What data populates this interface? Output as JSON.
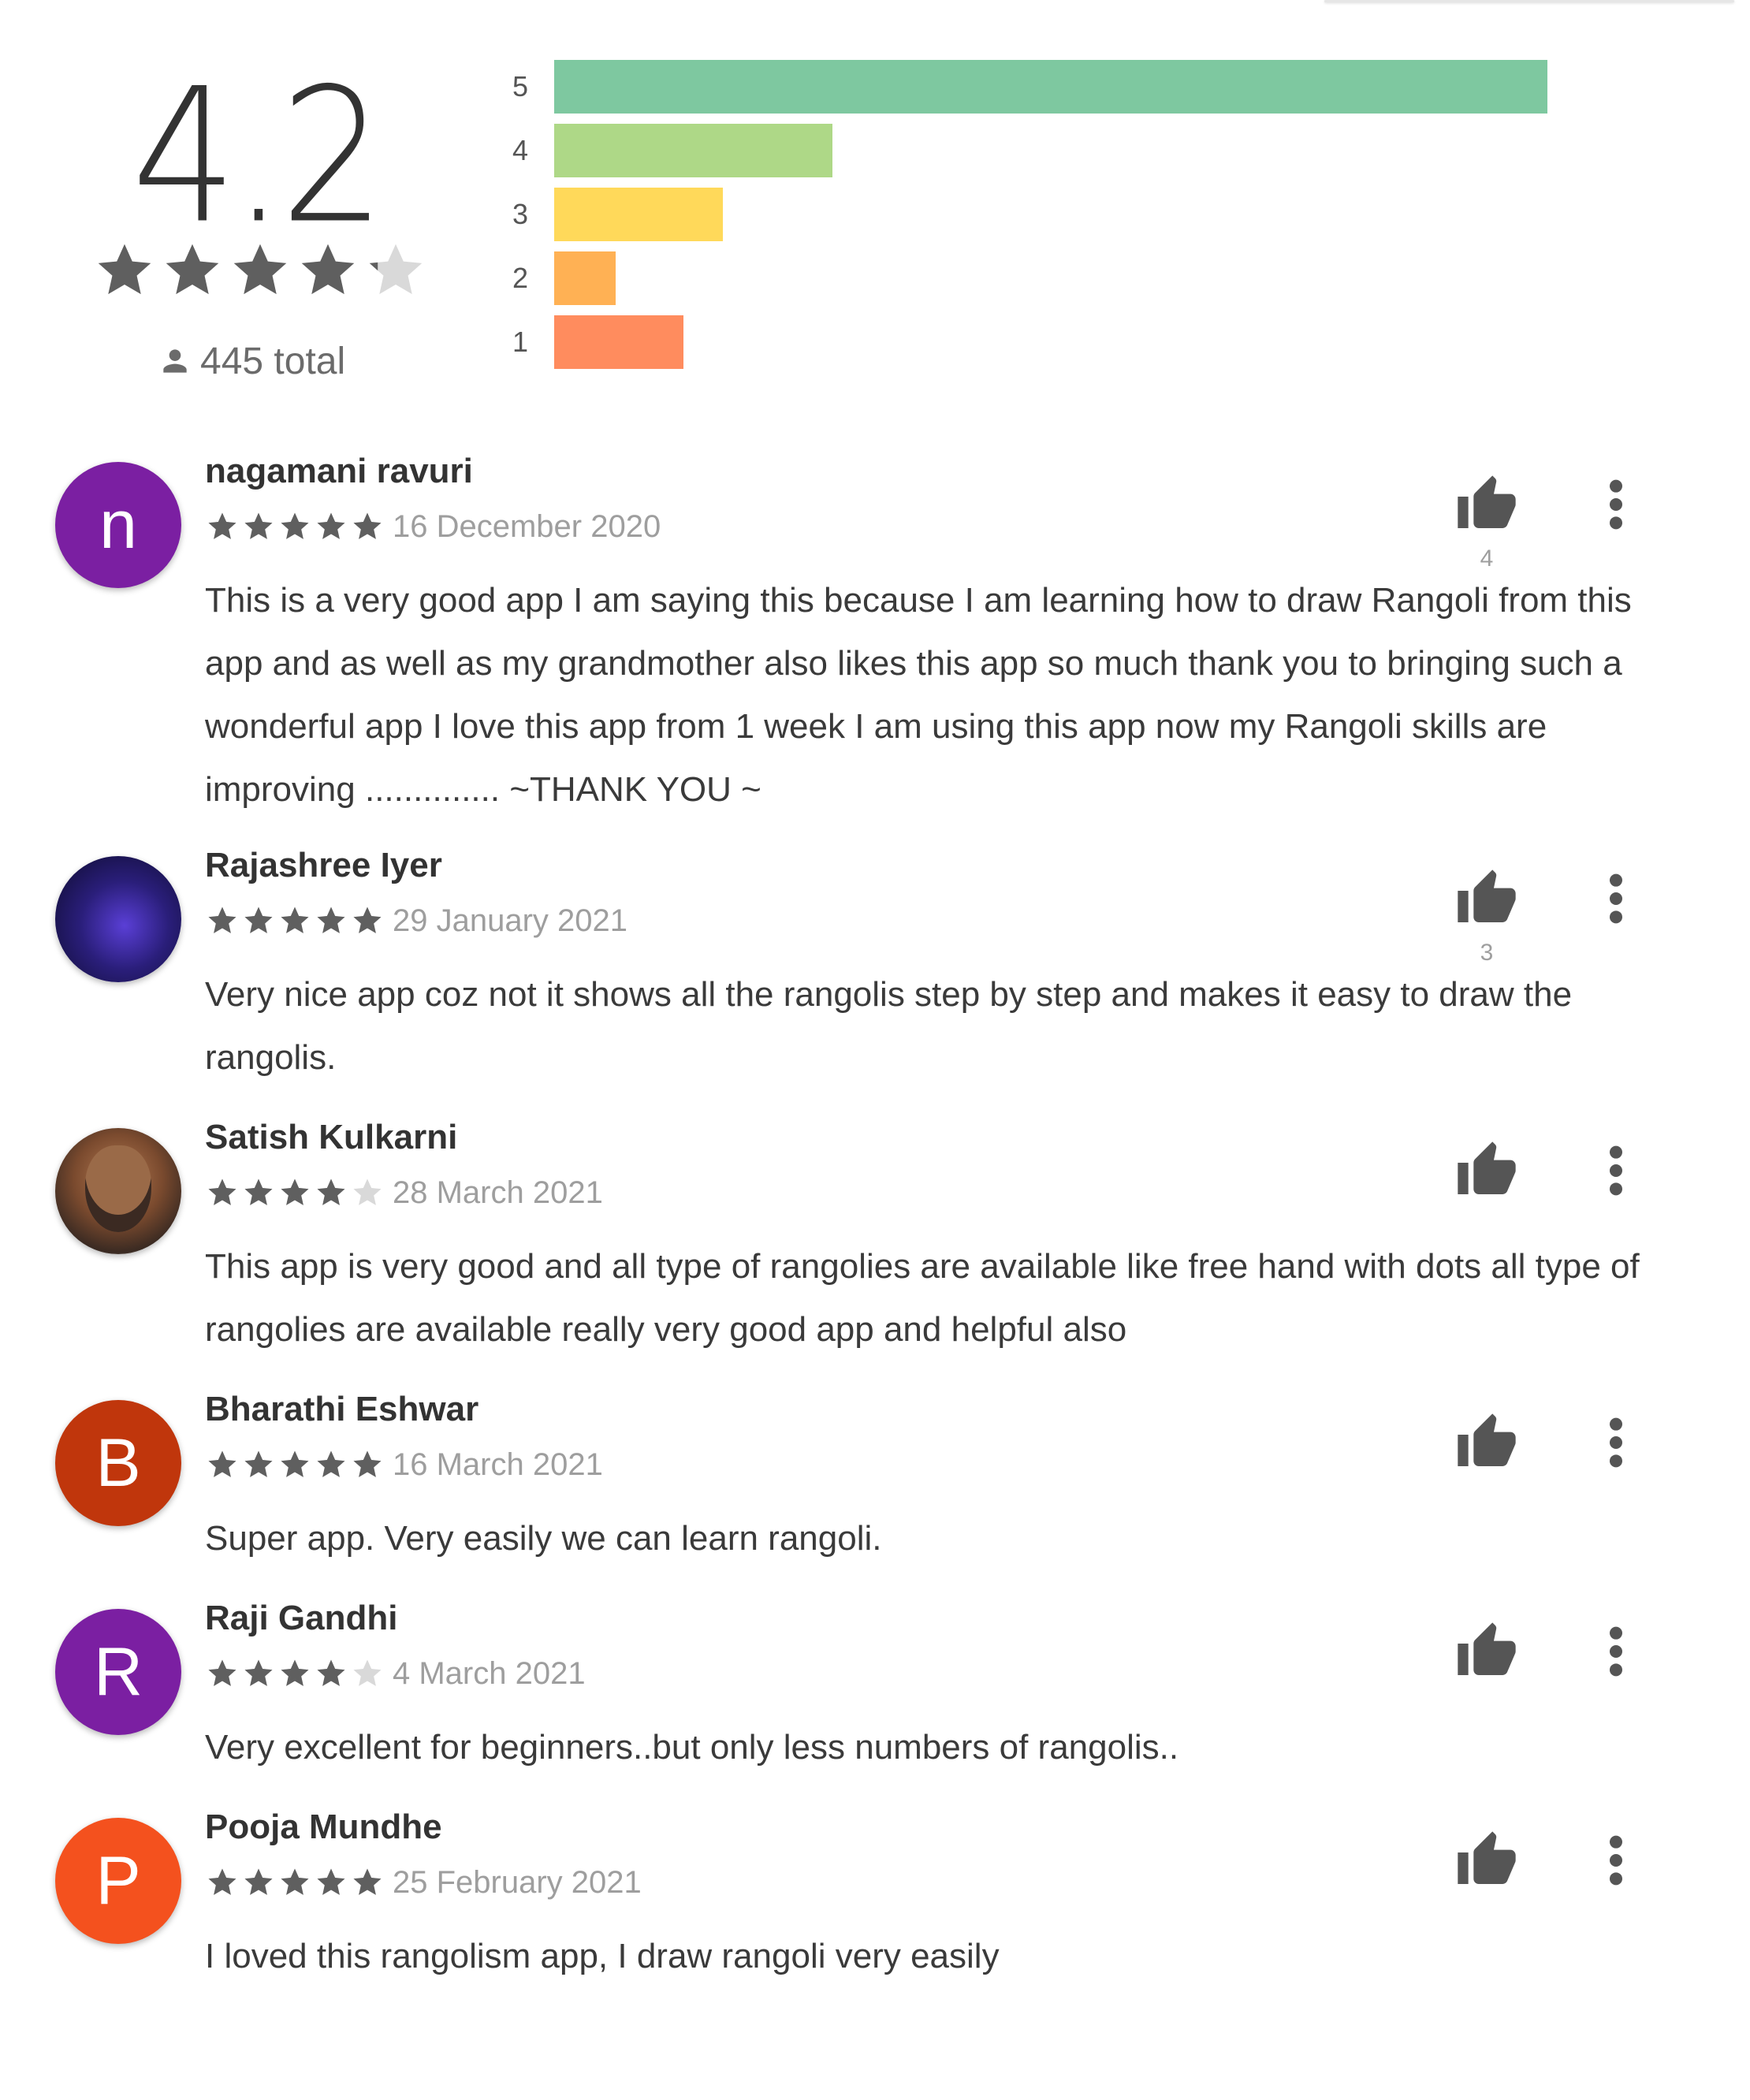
{
  "summary": {
    "score": "4.2",
    "stars": 4.2,
    "total_text": "445 total",
    "user_icon": "person-icon",
    "histogram": [
      {
        "label": "5",
        "fraction": 1.0,
        "color": "#7ec8a0"
      },
      {
        "label": "4",
        "fraction": 0.28,
        "color": "#aed887"
      },
      {
        "label": "3",
        "fraction": 0.17,
        "color": "#ffd95a"
      },
      {
        "label": "2",
        "fraction": 0.062,
        "color": "#ffb154"
      },
      {
        "label": "1",
        "fraction": 0.13,
        "color": "#ff8c5e"
      }
    ]
  },
  "colors": {
    "star_filled": "#5f5f5f",
    "star_empty": "#d9d9d9",
    "icon": "#555555"
  },
  "reviews": [
    {
      "name": "nagamani ravuri",
      "avatar_letter": "n",
      "avatar_color": "#7b1fa2",
      "rating": 5,
      "date": "16 December 2020",
      "likes": "4",
      "text": "This is a very good app I am saying this because I am learning how to draw Rangoli from this app and as well as my grandmother also likes this app so much thank you to bringing such a wonderful app I love this app from 1 week I am using this app now my Rangoli skills are improving .............. ~THANK YOU ~"
    },
    {
      "name": "Rajashree Iyer",
      "avatar_letter": "",
      "avatar_color": "#2a1e7a",
      "rating": 5,
      "date": "29 January 2021",
      "likes": "3",
      "text": "Very nice app coz not it shows all the rangolis step by step and makes it easy to draw the rangolis."
    },
    {
      "name": "Satish Kulkarni",
      "avatar_letter": "",
      "avatar_color": "#8a5a3c",
      "rating": 4,
      "date": "28 March 2021",
      "likes": "",
      "text": "This app is very good and all type of rangolies are available like free hand with dots all type of rangolies are available really very good app and helpful also"
    },
    {
      "name": "Bharathi Eshwar",
      "avatar_letter": "B",
      "avatar_color": "#c0360c",
      "rating": 5,
      "date": "16 March 2021",
      "likes": "",
      "text": "Super app. Very easily we can learn rangoli."
    },
    {
      "name": "Raji Gandhi",
      "avatar_letter": "R",
      "avatar_color": "#7b1fa2",
      "rating": 4,
      "date": "4 March 2021",
      "likes": "",
      "text": "Very excellent for beginners..but only less numbers of rangolis.."
    },
    {
      "name": "Pooja Mundhe",
      "avatar_letter": "P",
      "avatar_color": "#f4511e",
      "rating": 5,
      "date": "25 February 2021",
      "likes": "",
      "text": "I loved this rangolism app, I draw rangoli very easily"
    }
  ]
}
